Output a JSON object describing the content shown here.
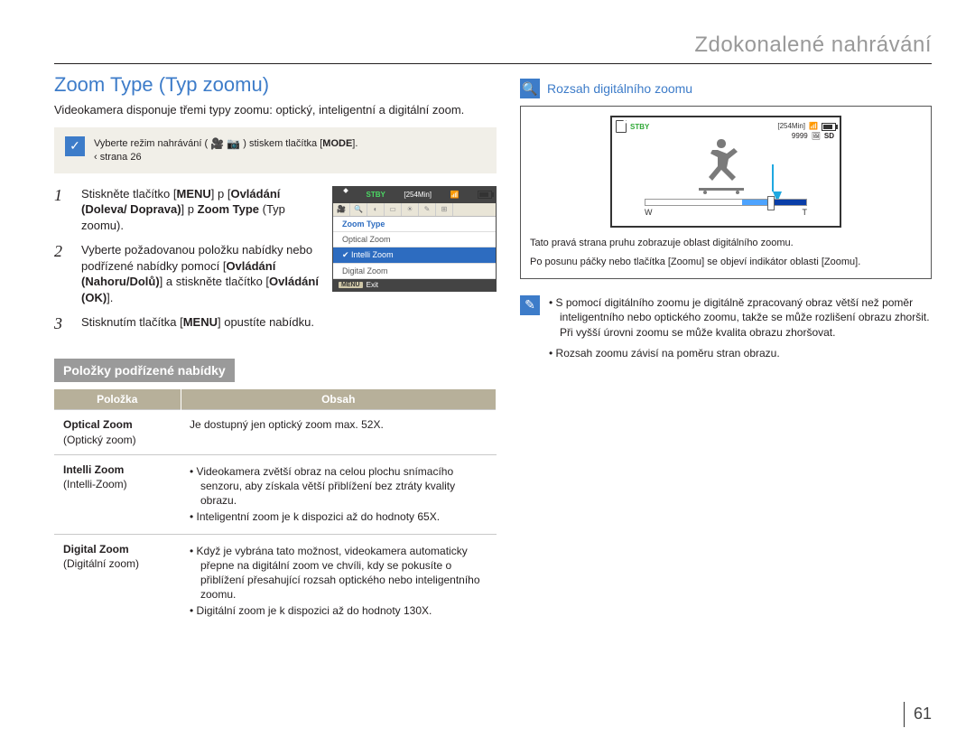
{
  "header": "Zdokonalené nahrávání",
  "section_title": "Zoom Type (Typ zoomu)",
  "intro": "Videokamera disponuje třemi typy zoomu: optický, inteligentní a digitální zoom.",
  "note": {
    "icon": "✓",
    "line1_pre": "Vyberte režim nahrávání (",
    "line1_post": ") stiskem tlačítka [",
    "mode": "MODE",
    "line1_end": "].",
    "ref": "‹ strana 26"
  },
  "steps": [
    {
      "n": "1",
      "html": "Stiskněte tlačítko [<b>MENU</b>] p [<b>Ovládání (Doleva/ Doprava)</b>] p <b>Zoom Type</b> (Typ zoomu)."
    },
    {
      "n": "2",
      "html": "Vyberte požadovanou položku nabídky nebo podřízené nabídky pomocí [<b>Ovládání (Nahoru/Dolů)</b>] a stiskněte tlačítko [<b>Ovládání (OK)</b>]."
    },
    {
      "n": "3",
      "html": "Stisknutím tlačítka [<b>MENU</b>] opustíte nabídku."
    }
  ],
  "menu_mock": {
    "stby": "STBY",
    "time": "[254Min]",
    "heading": "Zoom Type",
    "items": [
      "Optical Zoom",
      "Intelli Zoom",
      "Digital Zoom"
    ],
    "selected": "Intelli Zoom",
    "exit_chip": "MENU",
    "exit": "Exit"
  },
  "submenu_banner": "Položky podřízené nabídky",
  "table": {
    "h1": "Položka",
    "h2": "Obsah",
    "rows": [
      {
        "k": "Optical Zoom",
        "ks": "(Optický zoom)",
        "v": [
          "Je dostupný jen optický zoom max. 52X."
        ]
      },
      {
        "k": "Intelli Zoom",
        "ks": "(Intelli-Zoom)",
        "v": [
          "Videokamera zvětší obraz na celou plochu snímacího senzoru, aby získala větší přiblížení bez ztráty kvality obrazu.",
          "Inteligentní zoom je k dispozici až do hodnoty 65X."
        ]
      },
      {
        "k": "Digital Zoom",
        "ks": "(Digitální zoom)",
        "v": [
          "Když je vybrána tato možnost, videokamera automaticky přepne na digitální zoom ve chvíli, kdy se pokusíte o přiblížení přesahující rozsah optického nebo inteligentního zoomu.",
          "Digitální zoom je k dispozici až do hodnoty 130X."
        ]
      }
    ]
  },
  "right": {
    "icon": "🔍",
    "label": "Rozsah digitálního zoomu",
    "lcd": {
      "stby": "STBY",
      "time": "[254Min]",
      "shots": "9999",
      "w": "W",
      "t": "T",
      "sd": "SD"
    },
    "caption1": "Tato pravá strana pruhu zobrazuje oblast digitálního zoomu.",
    "caption2": "Po posunu páčky nebo tlačítka [Zoomu] se objeví indikátor oblasti [Zoomu].",
    "tips": [
      "S pomocí digitálního zoomu je digitálně zpracovaný obraz větší než poměr inteligentního nebo optického zoomu, takže se může rozlišení obrazu zhoršit. Při vyšší úrovni zoomu se může kvalita obrazu zhoršovat.",
      "Rozsah zoomu závisí na poměru stran obrazu."
    ]
  },
  "page_number": "61"
}
